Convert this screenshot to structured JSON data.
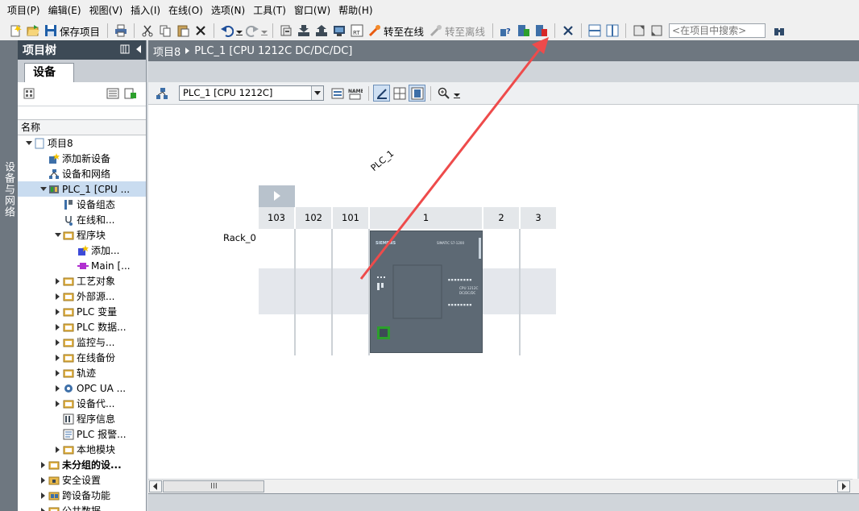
{
  "menu": [
    "项目(P)",
    "编辑(E)",
    "视图(V)",
    "插入(I)",
    "在线(O)",
    "选项(N)",
    "工具(T)",
    "窗口(W)",
    "帮助(H)"
  ],
  "toolbar": {
    "save_project": "保存项目",
    "go_online": "转至在线",
    "go_offline": "转至离线",
    "search_placeholder": "<在项目中搜索>"
  },
  "side_tab": {
    "label": "设备与网络"
  },
  "tree": {
    "title": "项目树",
    "tab": "设备",
    "column_header": "名称",
    "items": [
      {
        "label": "项目8",
        "indent": 0,
        "arrow": "down",
        "icon": "project-icon"
      },
      {
        "label": "添加新设备",
        "indent": 1,
        "arrow": "none",
        "icon": "add-device-icon"
      },
      {
        "label": "设备和网络",
        "indent": 1,
        "arrow": "none",
        "icon": "network-icon"
      },
      {
        "label": "PLC_1 [CPU ...",
        "indent": 1,
        "arrow": "down",
        "icon": "plc-icon",
        "selected": true
      },
      {
        "label": "设备组态",
        "indent": 2,
        "arrow": "none",
        "icon": "device-config-icon"
      },
      {
        "label": "在线和...",
        "indent": 2,
        "arrow": "none",
        "icon": "online-diagnostics-icon"
      },
      {
        "label": "程序块",
        "indent": 2,
        "arrow": "down",
        "icon": "folder-icon"
      },
      {
        "label": "添加...",
        "indent": 3,
        "arrow": "none",
        "icon": "add-block-icon"
      },
      {
        "label": "Main [...",
        "indent": 3,
        "arrow": "none",
        "icon": "ob-block-icon"
      },
      {
        "label": "工艺对象",
        "indent": 2,
        "arrow": "right",
        "icon": "folder-icon"
      },
      {
        "label": "外部源...",
        "indent": 2,
        "arrow": "right",
        "icon": "folder-icon"
      },
      {
        "label": "PLC 变量",
        "indent": 2,
        "arrow": "right",
        "icon": "folder-icon"
      },
      {
        "label": "PLC 数据...",
        "indent": 2,
        "arrow": "right",
        "icon": "folder-icon"
      },
      {
        "label": "监控与...",
        "indent": 2,
        "arrow": "right",
        "icon": "folder-icon"
      },
      {
        "label": "在线备份",
        "indent": 2,
        "arrow": "right",
        "icon": "folder-icon"
      },
      {
        "label": "轨迹",
        "indent": 2,
        "arrow": "right",
        "icon": "folder-icon"
      },
      {
        "label": "OPC UA ...",
        "indent": 2,
        "arrow": "right",
        "icon": "opc-icon"
      },
      {
        "label": "设备代...",
        "indent": 2,
        "arrow": "right",
        "icon": "folder-icon"
      },
      {
        "label": "程序信息",
        "indent": 2,
        "arrow": "none",
        "icon": "program-info-icon"
      },
      {
        "label": "PLC 报警...",
        "indent": 2,
        "arrow": "none",
        "icon": "alarm-text-icon"
      },
      {
        "label": "本地模块",
        "indent": 2,
        "arrow": "right",
        "icon": "folder-icon"
      },
      {
        "label": "未分组的设...",
        "indent": 1,
        "arrow": "right",
        "icon": "folder-icon",
        "bold": true
      },
      {
        "label": "安全设置",
        "indent": 1,
        "arrow": "right",
        "icon": "security-icon"
      },
      {
        "label": "跨设备功能",
        "indent": 1,
        "arrow": "right",
        "icon": "cross-device-icon"
      },
      {
        "label": "公共数据",
        "indent": 1,
        "arrow": "right",
        "icon": "folder-icon"
      }
    ]
  },
  "breadcrumb": [
    "项目8",
    "PLC_1 [CPU 1212C DC/DC/DC]"
  ],
  "editor": {
    "device_select": "PLC_1 [CPU 1212C]",
    "plc_name": "PLC_1",
    "rack_name": "Rack_0",
    "slots": [
      "103",
      "102",
      "101",
      "1",
      "2",
      "3"
    ],
    "cpu_brand": "SIEMENS",
    "cpu_series": "SIMATIC S7-1200",
    "cpu_model": "CPU 1212C",
    "cpu_variant": "DC/DC/DC"
  },
  "scroll": {
    "thumb_label": "III"
  },
  "colors": {
    "header_dark": "#3d4a56",
    "breadcrumb_bg": "#6e7780",
    "cpu_body": "#5d6974",
    "arrow_annotation": "#ee4b4b",
    "selection": "#c9dcf0"
  }
}
